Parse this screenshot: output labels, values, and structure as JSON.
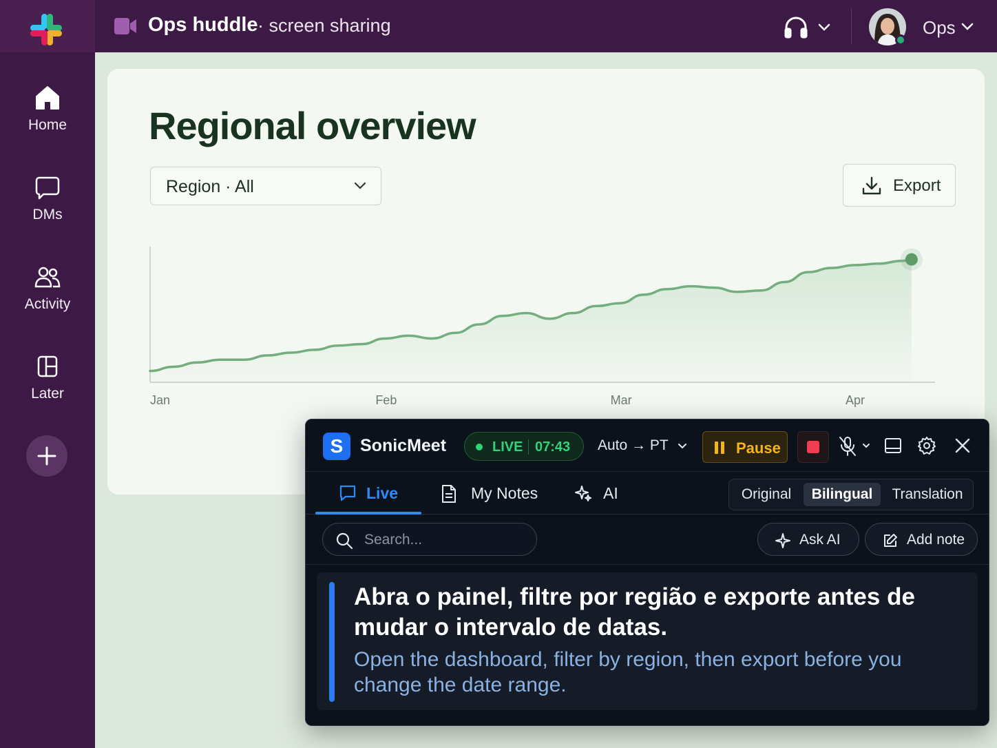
{
  "app": {
    "name": "Slack"
  },
  "header": {
    "call_icon": "video-camera-icon",
    "call_title": "Ops huddle",
    "call_subtitle": "· screen sharing",
    "audio_icon": "headphones-icon",
    "user_name": "Ops",
    "user_status": "online"
  },
  "sidebar": {
    "items": [
      {
        "label": "Home",
        "icon": "home-icon"
      },
      {
        "label": "DMs",
        "icon": "message-icon"
      },
      {
        "label": "Activity",
        "icon": "people-icon"
      },
      {
        "label": "Later",
        "icon": "bookmark-panel-icon"
      }
    ],
    "add_icon": "plus-icon"
  },
  "dashboard": {
    "title": "Regional overview",
    "region_filter": "Region · All",
    "export_label": "Export"
  },
  "chart_data": {
    "type": "area",
    "title": "",
    "xlabel": "",
    "ylabel": "",
    "x_ticks": [
      "Jan",
      "Feb",
      "Mar",
      "Apr"
    ],
    "x": [
      0,
      0.5,
      1,
      1.5,
      2,
      2.5,
      3,
      3.5,
      4,
      4.5,
      5,
      5.5,
      6,
      6.5,
      7,
      7.5,
      8,
      8.5,
      9,
      9.5,
      10,
      10.5,
      11,
      11.5,
      12,
      12.5,
      13,
      13.5,
      14,
      14.5,
      15,
      15.5,
      16,
      16.2
    ],
    "y": [
      8,
      11,
      14,
      16,
      16,
      19,
      21,
      23,
      26,
      27,
      31,
      33,
      31,
      35,
      41,
      47,
      49,
      45,
      49,
      54,
      56,
      62,
      66,
      68,
      67,
      64,
      65,
      71,
      78,
      81,
      83,
      84,
      86,
      87
    ],
    "ylim": [
      0,
      100
    ],
    "xlim": [
      0,
      16.7
    ],
    "series_color": "#74ae7e",
    "highlight_last_point": true,
    "grid": false,
    "legend": "none"
  },
  "sonicmeet": {
    "brand": "SonicMeet",
    "logo_letter": "S",
    "live_label": "LIVE",
    "timer": "07:43",
    "language": "Auto → PT",
    "pause_label": "Pause",
    "tabs": [
      {
        "label": "Live",
        "icon": "chat-bubble-icon",
        "active": true
      },
      {
        "label": "My Notes",
        "icon": "document-icon",
        "active": false
      },
      {
        "label": "AI",
        "icon": "sparkles-icon",
        "active": false
      }
    ],
    "view_modes": [
      "Original",
      "Bilingual",
      "Translation"
    ],
    "active_view_mode": "Bilingual",
    "search_placeholder": "Search...",
    "ask_ai_label": "Ask AI",
    "add_note_label": "Add note",
    "caption": {
      "original": "Abra o painel, filtre por região e exporte antes de mudar o intervalo de datas.",
      "translation": "Open the dashboard, filter by region, then export before you change the date range."
    },
    "colors": {
      "accent": "#2e8bf5",
      "live": "#33d27a",
      "pause": "#f4b519",
      "stop": "#ef3d52"
    }
  }
}
